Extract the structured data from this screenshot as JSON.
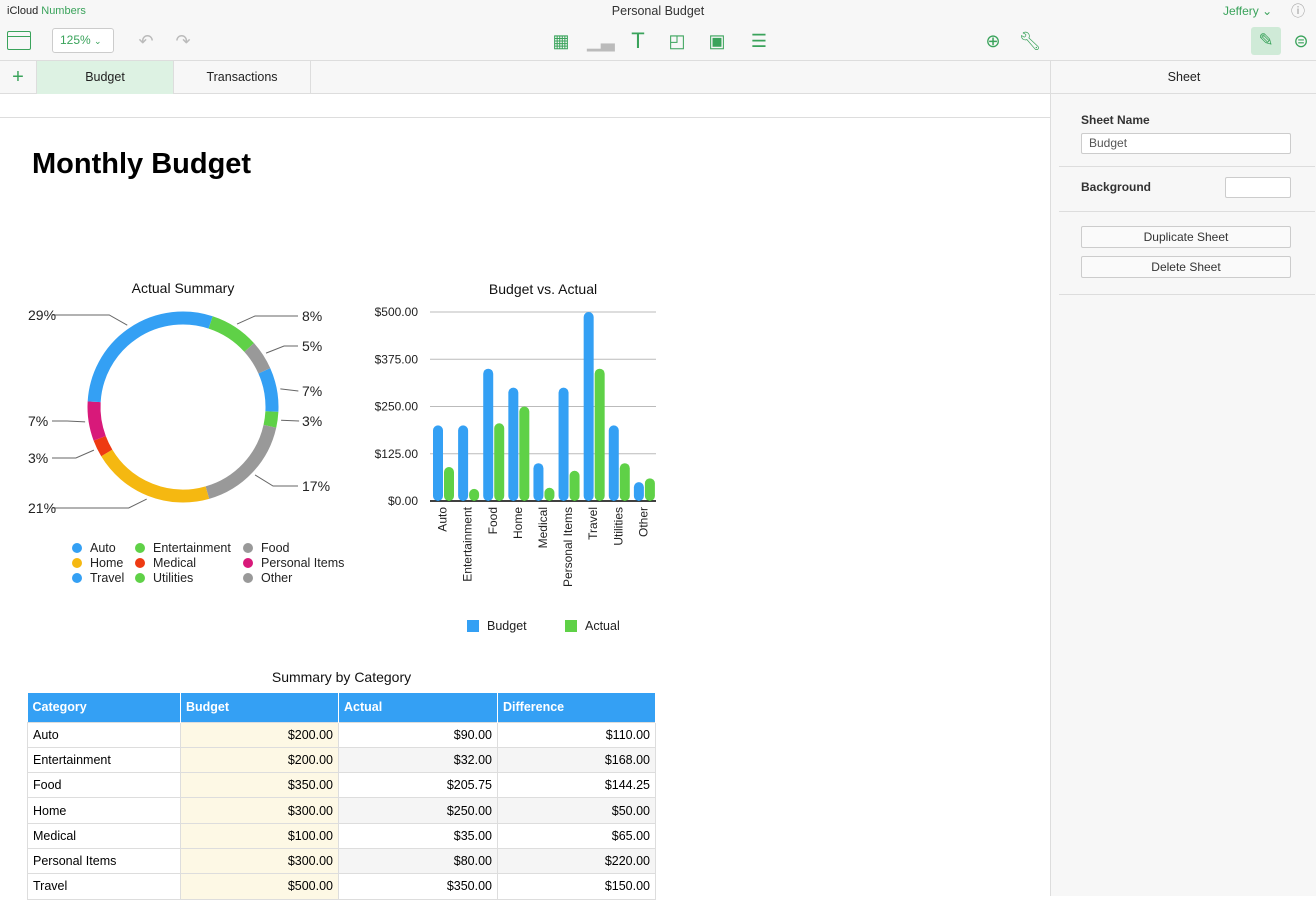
{
  "app": {
    "brand_icloud": "iCloud",
    "brand_app": "Numbers",
    "doc_title": "Personal Budget",
    "user": "Jeffery",
    "zoom": "125%"
  },
  "toolbar": {
    "icons": [
      "sidebar-icon",
      "undo-icon",
      "redo-icon",
      "table-icon",
      "chart-icon",
      "text-icon",
      "shape-icon",
      "media-icon",
      "comment-icon",
      "collaborate-icon",
      "wrench-icon",
      "format-brush-icon",
      "sort-filter-icon",
      "help-icon"
    ]
  },
  "tabs": [
    {
      "label": "Budget",
      "active": true
    },
    {
      "label": "Transactions",
      "active": false
    }
  ],
  "panel": {
    "title": "Sheet",
    "sheet_name_label": "Sheet Name",
    "sheet_name_value": "Budget",
    "background_label": "Background",
    "background_color": "#ffffff",
    "duplicate": "Duplicate Sheet",
    "delete": "Delete Sheet"
  },
  "page": {
    "title": "Monthly Budget"
  },
  "chart_data": [
    {
      "type": "pie",
      "title": "Actual Summary",
      "donut": true,
      "categories": [
        "Auto",
        "Entertainment",
        "Food",
        "Home",
        "Medical",
        "Personal Items",
        "Travel",
        "Utilities",
        "Other"
      ],
      "values": [
        90,
        32,
        205.75,
        250,
        35,
        80,
        350,
        100,
        60
      ],
      "labels": [
        "7%",
        "3%",
        "17%",
        "21%",
        "3%",
        "7%",
        "29%",
        "8%",
        "5%"
      ],
      "colors": [
        "#34a0f4",
        "#5fd147",
        "#999999",
        "#f5b811",
        "#ee3a12",
        "#d8197a",
        "#34a0f4",
        "#5fd147",
        "#999999"
      ],
      "legend": "bottom"
    },
    {
      "type": "bar",
      "title": "Budget vs. Actual",
      "categories": [
        "Auto",
        "Entertainment",
        "Food",
        "Home",
        "Medical",
        "Personal Items",
        "Travel",
        "Utilities",
        "Other"
      ],
      "series": [
        {
          "name": "Budget",
          "color": "#34a0f4",
          "values": [
            200,
            200,
            350,
            300,
            100,
            300,
            500,
            200,
            50
          ]
        },
        {
          "name": "Actual",
          "color": "#5fd147",
          "values": [
            90,
            32,
            205.75,
            250,
            35,
            80,
            350,
            100,
            60
          ]
        }
      ],
      "yticks": [
        "$0.00",
        "$125.00",
        "$250.00",
        "$375.00",
        "$500.00"
      ],
      "ylim": [
        0,
        500
      ],
      "grid": true,
      "legend": "bottom"
    },
    {
      "type": "table",
      "title": "Summary by Category",
      "columns": [
        "Category",
        "Budget",
        "Actual",
        "Difference"
      ],
      "rows": [
        [
          "Auto",
          "$200.00",
          "$90.00",
          "$110.00"
        ],
        [
          "Entertainment",
          "$200.00",
          "$32.00",
          "$168.00"
        ],
        [
          "Food",
          "$350.00",
          "$205.75",
          "$144.25"
        ],
        [
          "Home",
          "$300.00",
          "$250.00",
          "$50.00"
        ],
        [
          "Medical",
          "$100.00",
          "$35.00",
          "$65.00"
        ],
        [
          "Personal Items",
          "$300.00",
          "$80.00",
          "$220.00"
        ],
        [
          "Travel",
          "$500.00",
          "$350.00",
          "$150.00"
        ]
      ]
    }
  ]
}
